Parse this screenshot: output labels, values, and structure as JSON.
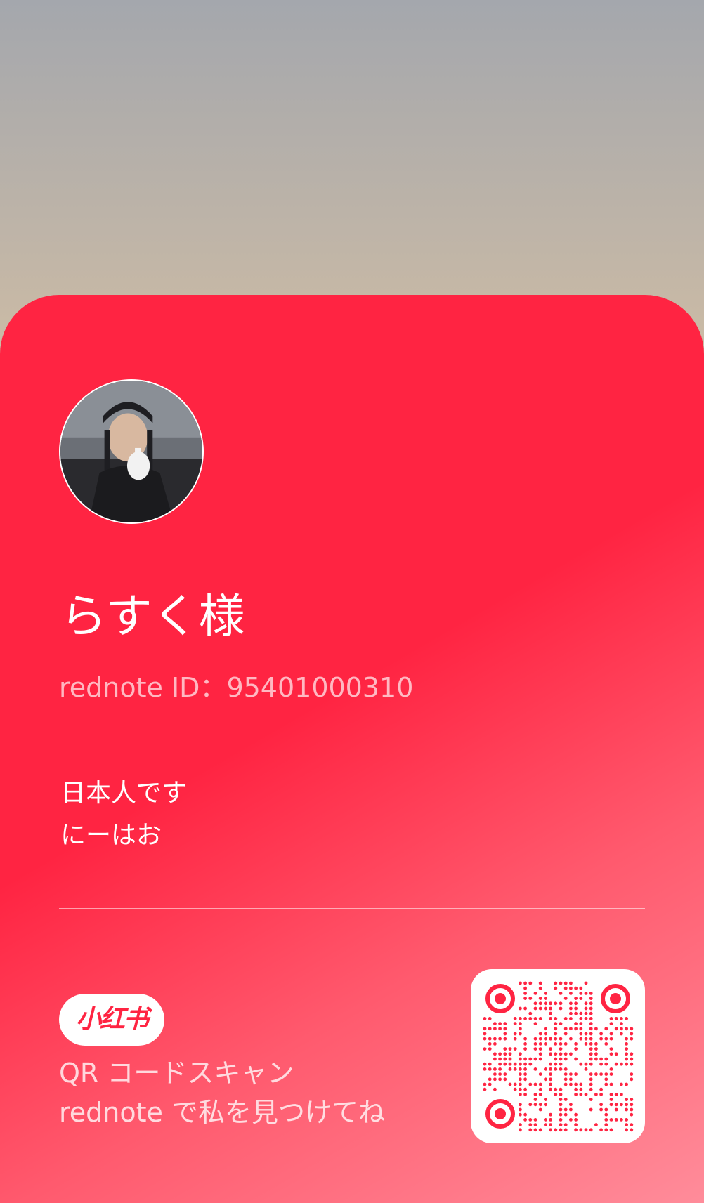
{
  "profile": {
    "display_name": "らすく様",
    "id_line": "rednote ID：95401000310",
    "bio_lines": [
      "日本人です",
      "にーはお"
    ]
  },
  "brand": {
    "logo_text": "小红书",
    "scan_line_1": "QR コードスキャン",
    "scan_line_2": "rednote で私を見つけてね"
  },
  "colors": {
    "brand_red": "#ff2442",
    "card_gradient_end": "#ff8c9a"
  },
  "icons": {
    "avatar": "profile-photo",
    "qr": "qr-code"
  }
}
